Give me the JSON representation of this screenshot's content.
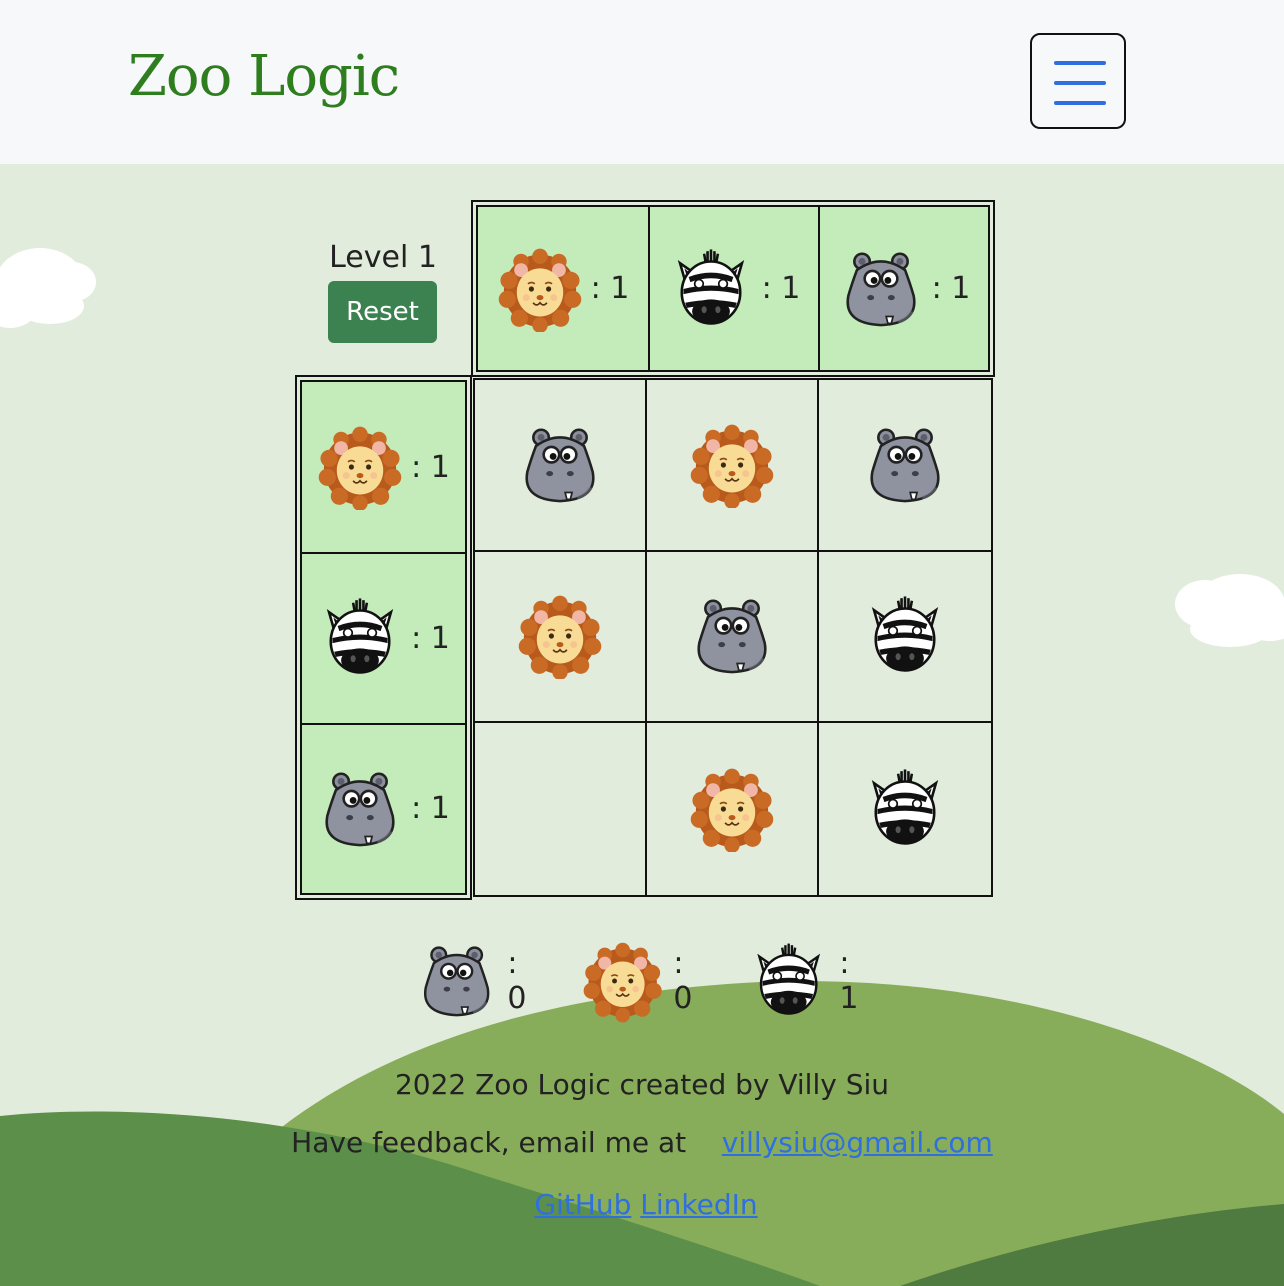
{
  "navbar": {
    "brand": "Zoo Logic"
  },
  "level": {
    "label": "Level 1",
    "reset_label": "Reset"
  },
  "column_clues": [
    {
      "animal": "lion",
      "count": ": 1"
    },
    {
      "animal": "zebra",
      "count": ": 1"
    },
    {
      "animal": "hippo",
      "count": ": 1"
    }
  ],
  "row_clues": [
    {
      "animal": "lion",
      "count": ": 1"
    },
    {
      "animal": "zebra",
      "count": ": 1"
    },
    {
      "animal": "hippo",
      "count": ": 1"
    }
  ],
  "grid": [
    [
      "hippo",
      "lion",
      "hippo"
    ],
    [
      "lion",
      "hippo",
      "zebra"
    ],
    [
      "",
      "lion",
      "zebra"
    ]
  ],
  "counters": [
    {
      "animal": "hippo",
      "count": ": 0"
    },
    {
      "animal": "lion",
      "count": ": 0"
    },
    {
      "animal": "zebra",
      "count": ": 1"
    }
  ],
  "footer": {
    "credit": "2022 Zoo Logic created by Villy Siu",
    "feedback": "Have feedback, email me at",
    "email": "villysiu@gmail.com",
    "github": "GitHub",
    "linkedin": "LinkedIn"
  },
  "colors": {
    "brand": "#2e7d1f",
    "clue_bg": "#c3ecba",
    "reset_bg": "#3b8250",
    "link": "#2f6fe0"
  }
}
